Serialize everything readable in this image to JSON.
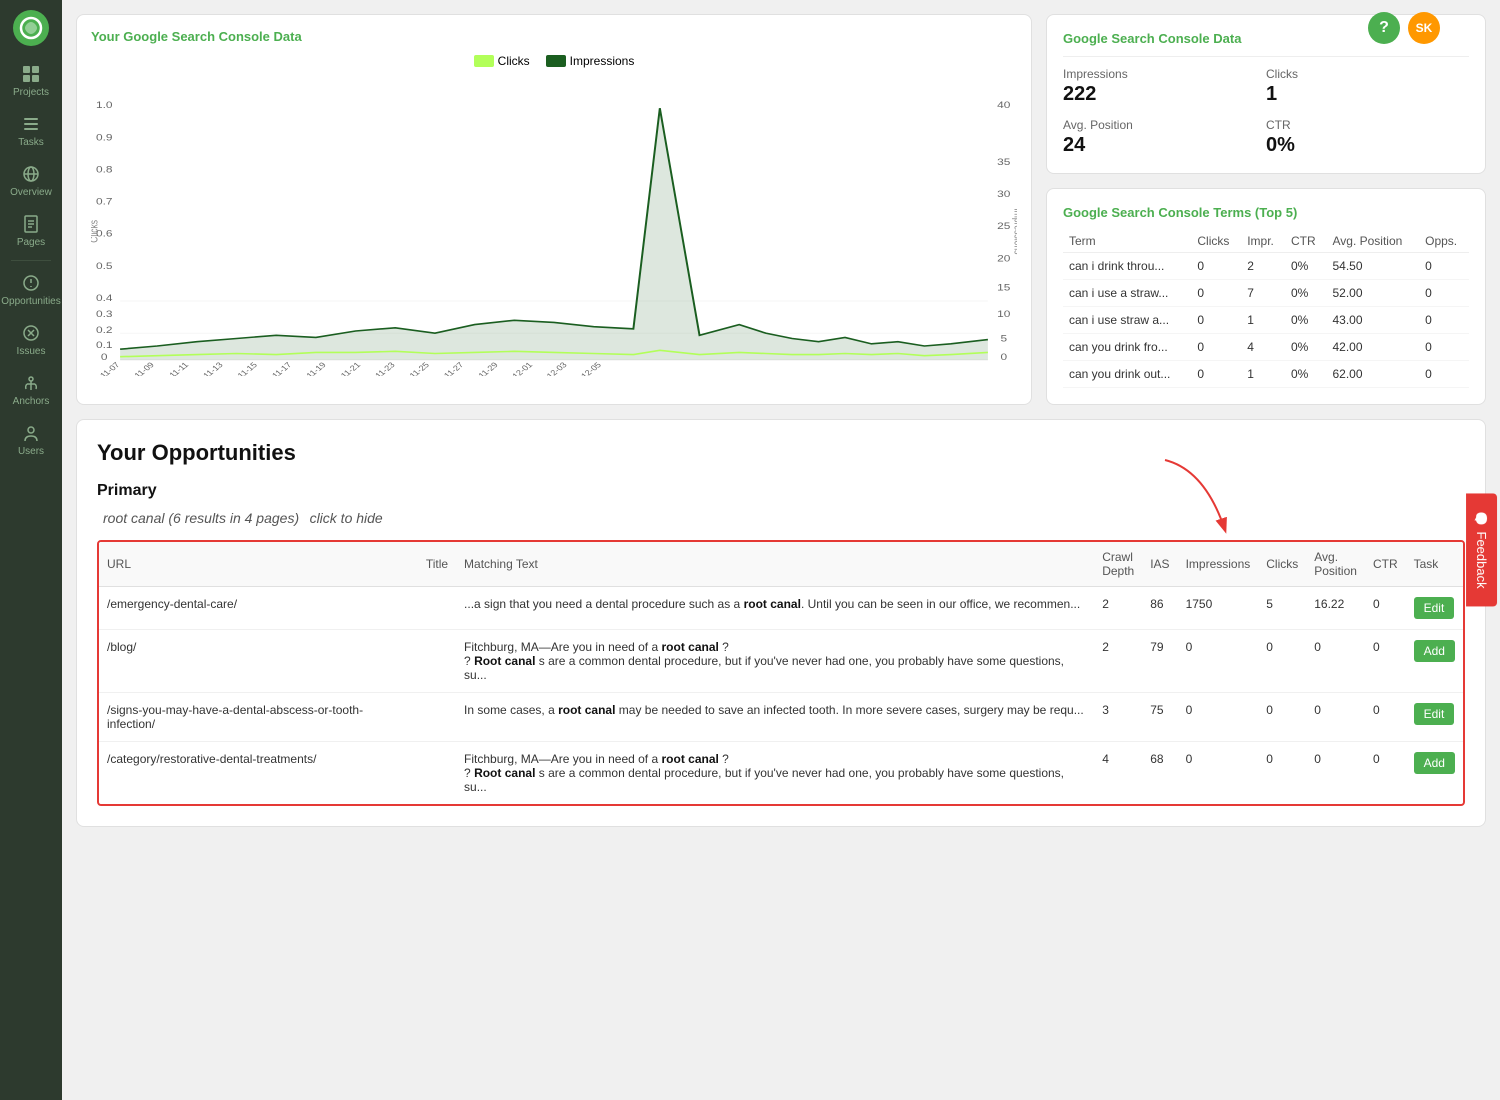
{
  "sidebar": {
    "logo": "○",
    "items": [
      {
        "id": "projects",
        "label": "Projects",
        "icon": "grid"
      },
      {
        "id": "tasks",
        "label": "Tasks",
        "icon": "list"
      },
      {
        "id": "overview",
        "label": "Overview",
        "icon": "eye"
      },
      {
        "id": "pages",
        "label": "Pages",
        "icon": "file"
      },
      {
        "id": "opportunities",
        "label": "Opportunities",
        "icon": "gear"
      },
      {
        "id": "issues",
        "label": "Issues",
        "icon": "link"
      },
      {
        "id": "anchors",
        "label": "Anchors",
        "icon": "anchor"
      },
      {
        "id": "users",
        "label": "Users",
        "icon": "person"
      }
    ]
  },
  "chart": {
    "title": "Your Google Search Console Data",
    "legend": {
      "clicks_label": "Clicks",
      "impressions_label": "Impressions",
      "clicks_color": "#b2ff59",
      "impressions_color": "#1b5e20"
    }
  },
  "gsc_stats": {
    "title": "Google Search Console Data",
    "impressions_label": "Impressions",
    "impressions_value": "222",
    "clicks_label": "Clicks",
    "clicks_value": "1",
    "avg_position_label": "Avg. Position",
    "avg_position_value": "24",
    "ctr_label": "CTR",
    "ctr_value": "0%"
  },
  "gsc_terms": {
    "title": "Google Search Console Terms (Top 5)",
    "columns": [
      "Term",
      "Clicks",
      "Impr.",
      "CTR",
      "Avg. Position",
      "Opps."
    ],
    "rows": [
      {
        "term": "can i drink throu...",
        "clicks": "0",
        "impr": "2",
        "ctr": "0%",
        "avg_position": "54.50",
        "opps": "0"
      },
      {
        "term": "can i use a straw...",
        "clicks": "0",
        "impr": "7",
        "ctr": "0%",
        "avg_position": "52.00",
        "opps": "0"
      },
      {
        "term": "can i use straw a...",
        "clicks": "0",
        "impr": "1",
        "ctr": "0%",
        "avg_position": "43.00",
        "opps": "0"
      },
      {
        "term": "can you drink fro...",
        "clicks": "0",
        "impr": "4",
        "ctr": "0%",
        "avg_position": "42.00",
        "opps": "0"
      },
      {
        "term": "can you drink out...",
        "clicks": "0",
        "impr": "1",
        "ctr": "0%",
        "avg_position": "62.00",
        "opps": "0"
      }
    ]
  },
  "opportunities": {
    "title": "Your Opportunities",
    "section_primary": "Primary",
    "query_title": "root canal (6 results in 4 pages)",
    "query_hide_label": "click to hide",
    "table_columns": [
      "URL",
      "Title",
      "Matching Text",
      "Crawl Depth",
      "IAS",
      "Impressions",
      "Clicks",
      "Avg. Position",
      "CTR",
      "Task"
    ],
    "rows": [
      {
        "url": "/emergency-dental-care/",
        "title": "",
        "matching_text_before": "...a sign that you need a dental procedure such as a ",
        "matching_text_bold": "root canal",
        "matching_text_after": ". Until you can be seen in our office, we recommen...",
        "crawl_depth": "2",
        "ias": "86",
        "impressions": "1750",
        "clicks": "5",
        "avg_position": "16.22",
        "ctr": "0",
        "task_btn": "Edit",
        "extra_text_before": "",
        "extra_text_bold": "",
        "extra_text_after": ""
      },
      {
        "url": "/blog/",
        "title": "",
        "matching_text_before": "Fitchburg, MA—Are you in need of a ",
        "matching_text_bold": "root canal",
        "matching_text_after": " ?",
        "crawl_depth": "2",
        "ias": "79",
        "impressions": "0",
        "clicks": "0",
        "avg_position": "0",
        "ctr": "0",
        "task_btn": "Add",
        "extra_text_before": "? ",
        "extra_text_bold": "Root canal",
        "extra_text_after": " s are a common dental procedure, but if you've never had one, you probably have some questions, su..."
      },
      {
        "url": "/signs-you-may-have-a-dental-abscess-or-tooth-infection/",
        "title": "",
        "matching_text_before": "In some cases, a ",
        "matching_text_bold": "root canal",
        "matching_text_after": " may be needed to save an infected tooth. In more severe cases, surgery may be requ...",
        "crawl_depth": "3",
        "ias": "75",
        "impressions": "0",
        "clicks": "0",
        "avg_position": "0",
        "ctr": "0",
        "task_btn": "Edit",
        "extra_text_before": "",
        "extra_text_bold": "",
        "extra_text_after": ""
      },
      {
        "url": "/category/restorative-dental-treatments/",
        "title": "",
        "matching_text_before": "Fitchburg, MA—Are you in need of a ",
        "matching_text_bold": "root canal",
        "matching_text_after": " ?",
        "crawl_depth": "4",
        "ias": "68",
        "impressions": "0",
        "clicks": "0",
        "avg_position": "0",
        "ctr": "0",
        "task_btn": "Add",
        "extra_text_before": "? ",
        "extra_text_bold": "Root canal",
        "extra_text_after": " s are a common dental procedure, but if you've never had one, you probably have some questions, su..."
      }
    ]
  },
  "feedback": {
    "label": "Feedback"
  },
  "top_buttons": {
    "help_label": "?",
    "user_label": "SK"
  }
}
